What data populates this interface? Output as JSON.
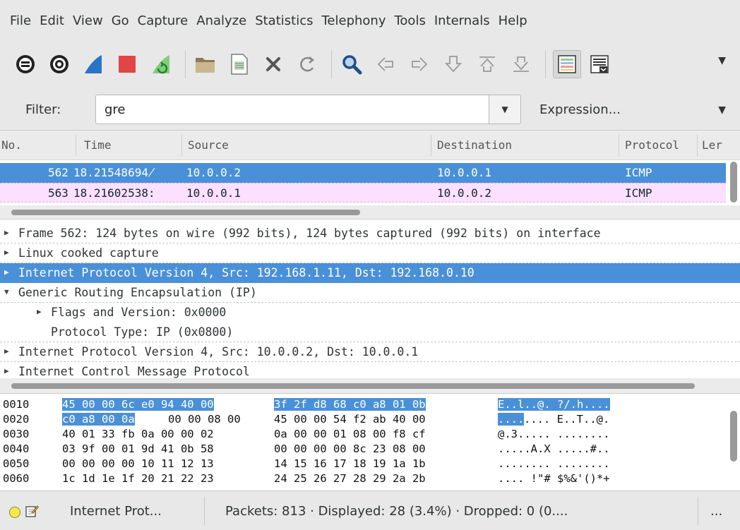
{
  "menubar": {
    "items": [
      "File",
      "Edit",
      "View",
      "Go",
      "Capture",
      "Analyze",
      "Statistics",
      "Telephony",
      "Tools",
      "Internals",
      "Help"
    ]
  },
  "toolbar": {
    "icons": [
      "interface-list-icon",
      "capture-options-icon",
      "start-capture-icon",
      "stop-capture-icon",
      "restart-capture-icon",
      "open-file-icon",
      "save-file-icon",
      "close-file-icon",
      "reload-icon",
      "find-packet-icon",
      "go-back-icon",
      "go-forward-icon",
      "go-to-packet-icon",
      "first-packet-icon",
      "last-packet-icon",
      "colorize-icon",
      "auto-scroll-icon"
    ]
  },
  "filter": {
    "label": "Filter:",
    "value": "gre",
    "expression_label": "Expression..."
  },
  "packet_list": {
    "columns": [
      "No.",
      "Time",
      "Source",
      "Destination",
      "Protocol",
      "Ler"
    ],
    "rows": [
      {
        "no": "562",
        "time": "18.21548694̸",
        "source": "10.0.0.2",
        "destination": "10.0.0.1",
        "protocol": "ICMP"
      },
      {
        "no": "563",
        "time": "18.21602538:",
        "source": "10.0.0.1",
        "destination": "10.0.0.2",
        "protocol": "ICMP"
      }
    ]
  },
  "details": [
    "Frame 562: 124 bytes on wire (992 bits), 124 bytes captured (992 bits) on interface",
    "Linux cooked capture",
    "Internet Protocol Version 4, Src: 192.168.1.11, Dst: 192.168.0.10",
    "Generic Routing Encapsulation (IP)",
    "Flags and Version: 0x0000",
    "Protocol Type: IP (0x0800)",
    "Internet Protocol Version 4, Src: 10.0.0.2, Dst: 10.0.0.1",
    "Internet Control Message Protocol"
  ],
  "bytes": {
    "rows": [
      {
        "offset": "0010",
        "hex_a": "45 00 00 6c e0 94 40 00",
        "hex_b": "3f 2f d8 68 c0 a8 01 0b",
        "ascii": "E..l..@. ?/.h...."
      },
      {
        "offset": "0020",
        "hex_sel": "c0 a8 00 0a",
        "hex_a": "00 00 08 00",
        "hex_b": "45 00 00 54 f2 ab 40 00",
        "ascii_sel": "....",
        "ascii": ".... E..T..@."
      },
      {
        "offset": "0030",
        "hex_a": "40 01 33 fb 0a 00 00 02",
        "hex_b": "0a 00 00 01 08 00 f8 cf",
        "ascii": "@.3..... ........"
      },
      {
        "offset": "0040",
        "hex_a": "03 9f 00 01 9d 41 0b 58",
        "hex_b": "00 00 00 00 8c 23 08 00",
        "ascii": ".....A.X .....#.."
      },
      {
        "offset": "0050",
        "hex_a": "00 00 00 00 10 11 12 13",
        "hex_b": "14 15 16 17 18 19 1a 1b",
        "ascii": "........ ........"
      },
      {
        "offset": "0060",
        "hex_a": "1c 1d 1e 1f 20 21 22 23",
        "hex_b": "24 25 26 27 28 29 2a 2b",
        "ascii": ".... !\"# $%&'()*+"
      }
    ]
  },
  "status": {
    "protocol": "Internet Prot...",
    "packets": "Packets: 813 · Displayed: 28 (3.4%)  · Dropped: 0 (0....",
    "more": "..."
  },
  "colors": {
    "selection": "#4a90d9",
    "icmp_row": "#fce0ff",
    "capture_start": "#2a74c8",
    "capture_stop": "#e04646",
    "capture_restart": "#5cb85c"
  }
}
